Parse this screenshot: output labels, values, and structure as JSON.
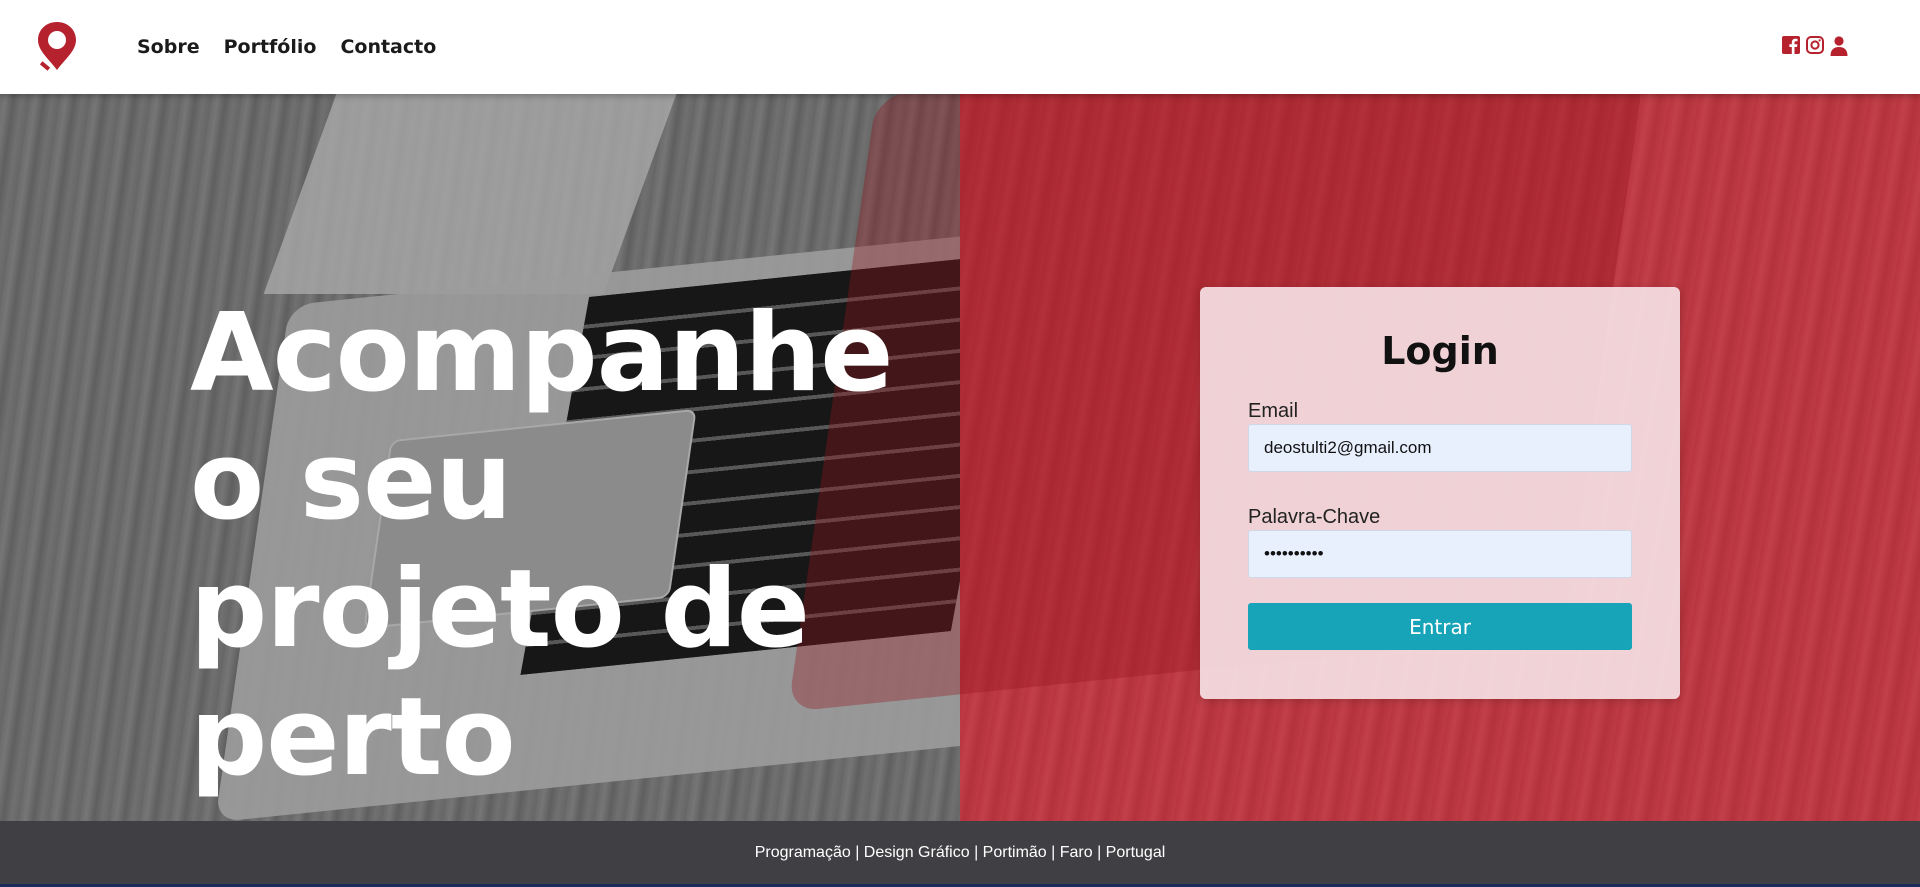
{
  "header": {
    "logo_icon": "map-pin-icon",
    "nav": [
      {
        "label": "Sobre"
      },
      {
        "label": "Portfólio"
      },
      {
        "label": "Contacto"
      }
    ],
    "social_icons": [
      "facebook-icon",
      "instagram-icon",
      "user-icon"
    ]
  },
  "hero": {
    "headline": "Acompanhe o seu projeto de perto"
  },
  "login": {
    "title": "Login",
    "email_label": "Email",
    "email_value": "deostulti2@gmail.com",
    "password_label": "Palavra-Chave",
    "password_value": "••••••••••",
    "submit_label": "Entrar"
  },
  "footer": {
    "text": "Programação | Design Gráfico | Portimão | Faro | Portugal"
  },
  "colors": {
    "brand_red": "#b5222e",
    "accent_teal": "#17a3b8",
    "footer_bg": "#404044"
  }
}
